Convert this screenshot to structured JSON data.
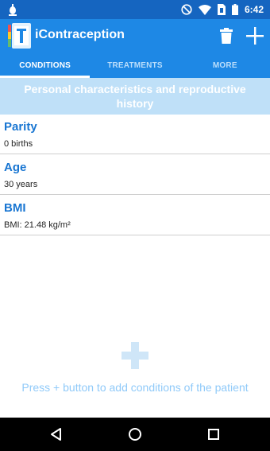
{
  "status_bar": {
    "time": "6:42",
    "icons": [
      "notification-bug-icon",
      "do-not-disturb-icon",
      "wifi-icon",
      "sim-icon",
      "battery-icon"
    ]
  },
  "app_bar": {
    "title": "iContraception",
    "actions": [
      "trash-icon",
      "add-icon"
    ]
  },
  "tabs": [
    {
      "label": "CONDITIONS",
      "active": true
    },
    {
      "label": "TREATMENTS",
      "active": false
    },
    {
      "label": "MORE",
      "active": false
    }
  ],
  "section": {
    "title": "Personal characteristics and reproductive history"
  },
  "conditions": [
    {
      "title": "Parity",
      "value": "0 births"
    },
    {
      "title": "Age",
      "value": "30 years"
    },
    {
      "title": "BMI",
      "value": "BMI: 21.48 kg/m²"
    }
  ],
  "empty_state": {
    "message": "Press + button to add conditions of the patient"
  },
  "nav_bar": {
    "buttons": [
      "back-icon",
      "home-icon",
      "recents-icon"
    ]
  },
  "colors": {
    "status_bar": "#1565c0",
    "app_bar": "#1e88e5",
    "section_header": "#bfe0f8",
    "item_title": "#1976d2",
    "empty_text": "#90caf9"
  }
}
